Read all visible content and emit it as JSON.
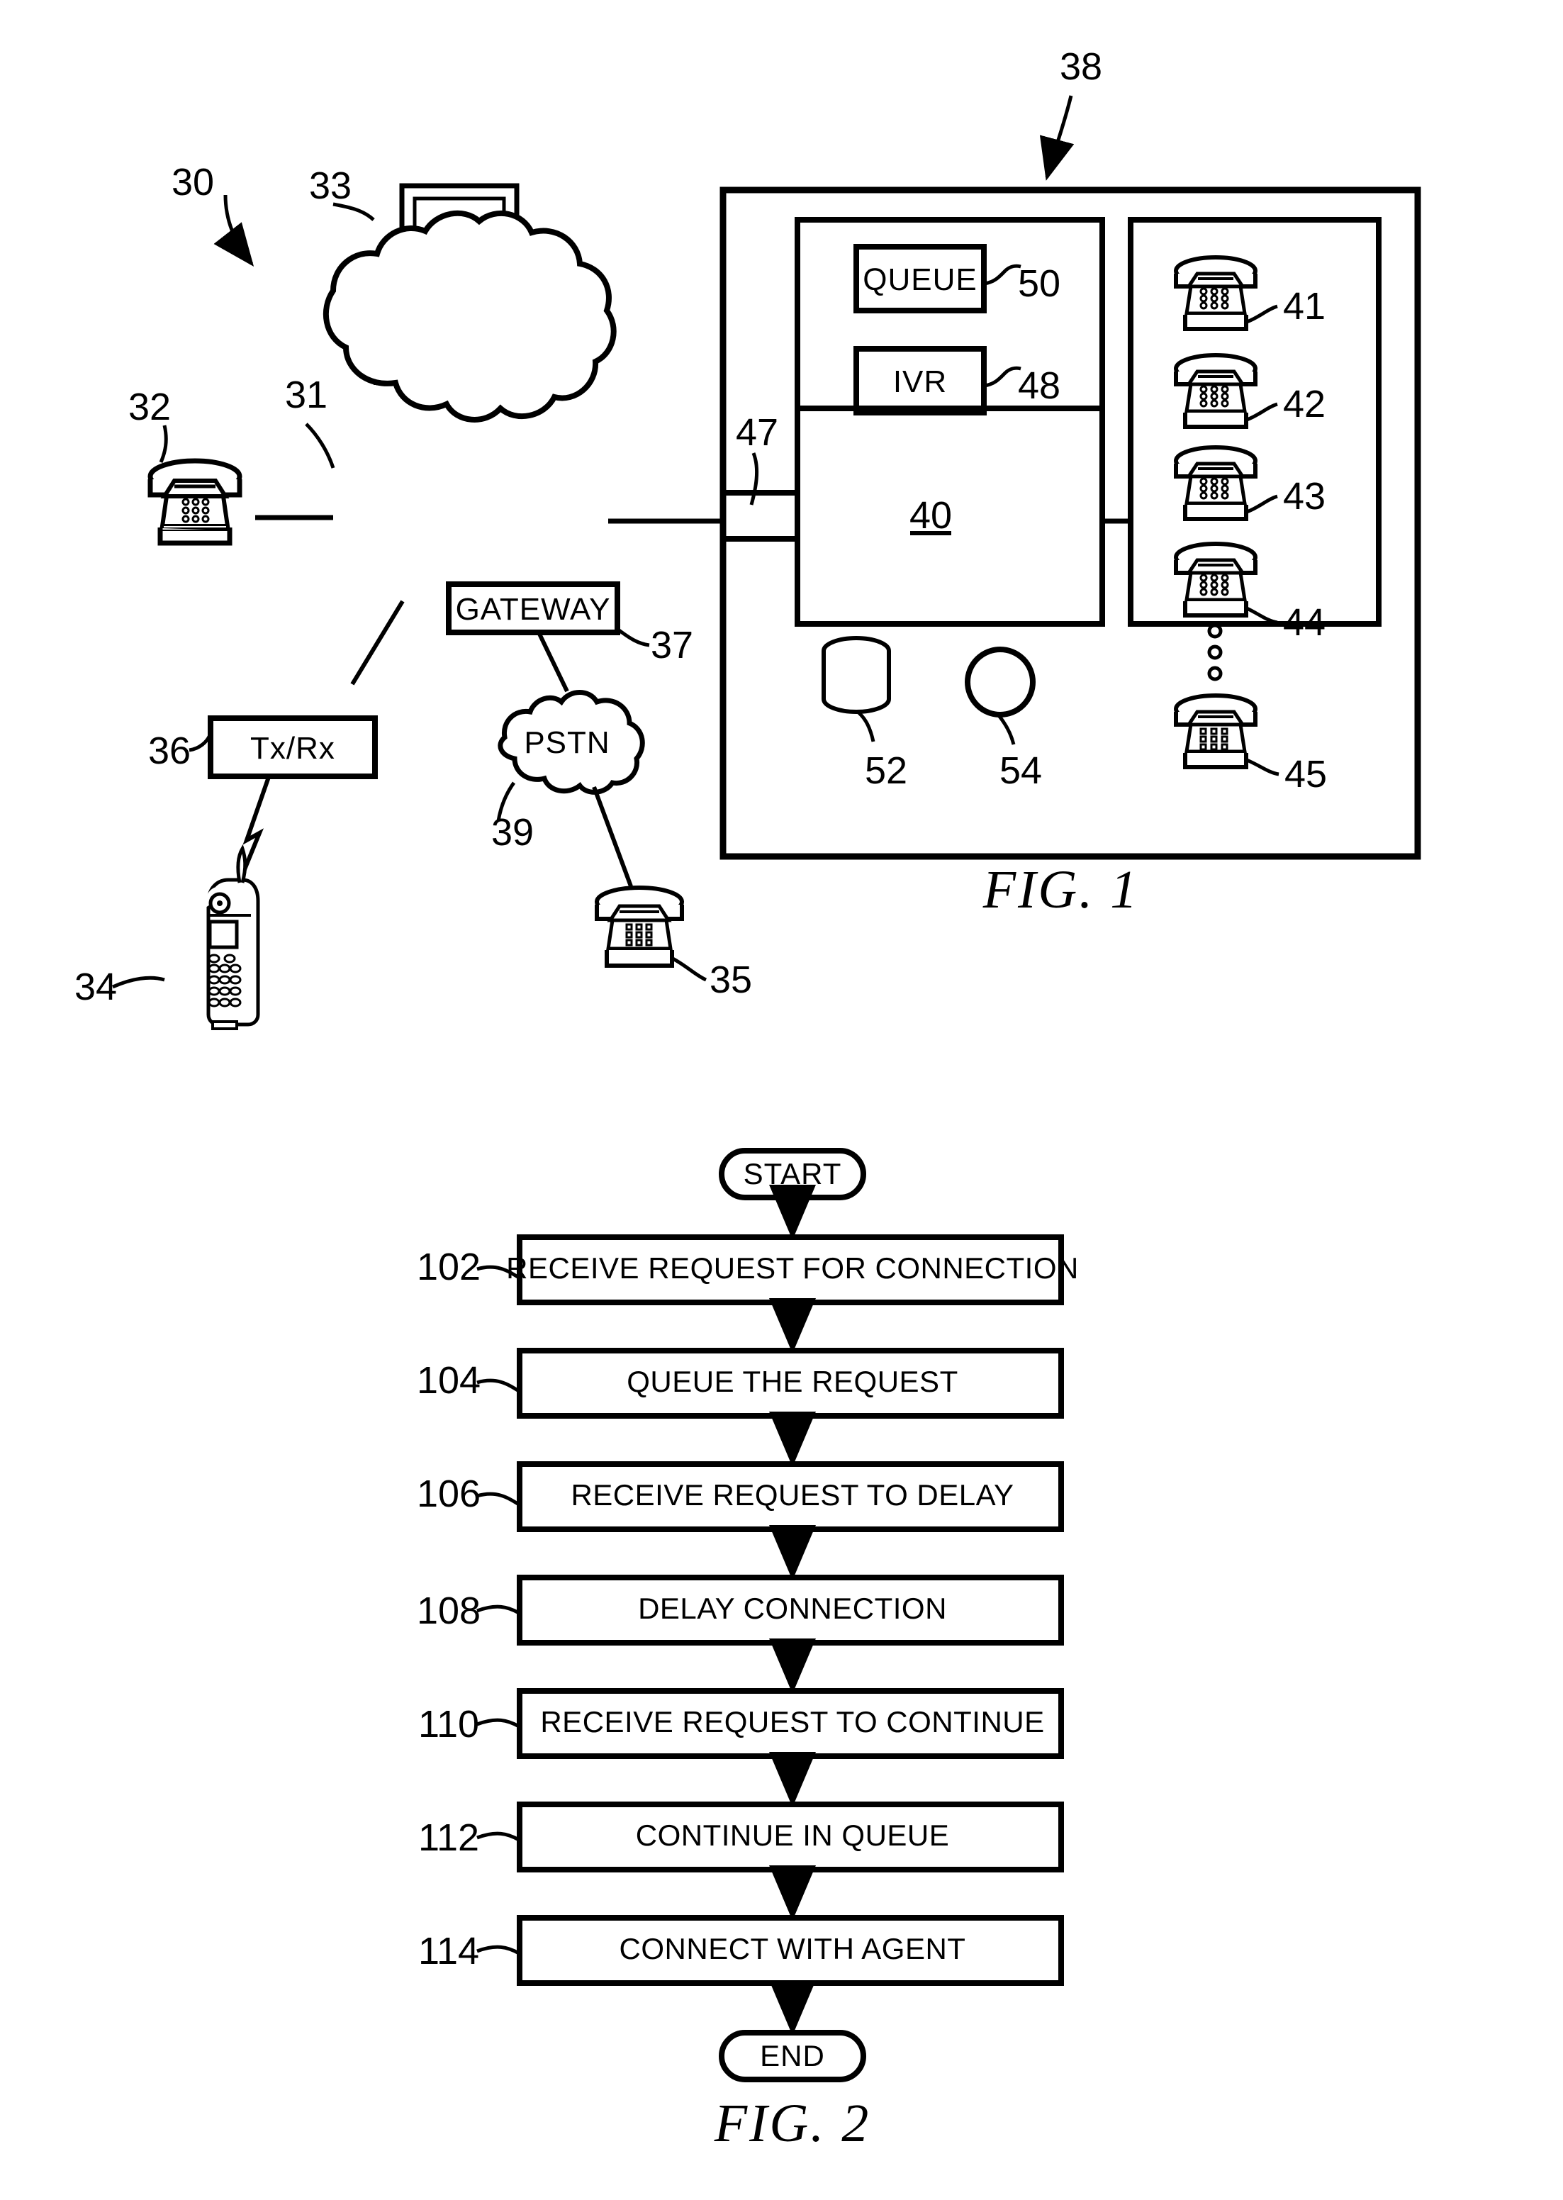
{
  "document": {
    "type": "patent-drawing-sheet",
    "figures": [
      "FIG. 1",
      "FIG. 2"
    ]
  },
  "fig1": {
    "caption": "FIG. 1",
    "system_ref": "30",
    "refs": {
      "system": "30",
      "network_cloud": "31",
      "telephone_left": "32",
      "computer": "33",
      "mobile_phone": "34",
      "pstn_telephone": "35",
      "transceiver": "36",
      "gateway": "37",
      "call_center": "38",
      "pstn_cloud": "39",
      "switch": "40",
      "agent_phone_1": "41",
      "agent_phone_2": "42",
      "agent_phone_3": "43",
      "agent_phone_4": "44",
      "agent_phone_n": "45",
      "trunk_interface": "47",
      "ivr": "48",
      "queue": "50",
      "database": "52",
      "processor": "54"
    },
    "labels": {
      "gateway": "GATEWAY",
      "pstn": "PSTN",
      "txrx": "Tx/Rx",
      "queue": "QUEUE",
      "ivr": "IVR",
      "switch": "40"
    },
    "agent_phones": [
      "41",
      "42",
      "43",
      "44",
      "45"
    ],
    "ellipsis_dots": 3
  },
  "fig2": {
    "caption": "FIG. 2",
    "start_label": "START",
    "end_label": "END",
    "steps": [
      {
        "ref": "102",
        "label": "RECEIVE REQUEST FOR CONNECTION"
      },
      {
        "ref": "104",
        "label": "QUEUE THE REQUEST"
      },
      {
        "ref": "106",
        "label": "RECEIVE REQUEST TO DELAY"
      },
      {
        "ref": "108",
        "label": "DELAY CONNECTION"
      },
      {
        "ref": "110",
        "label": "RECEIVE REQUEST TO CONTINUE"
      },
      {
        "ref": "112",
        "label": "CONTINUE IN QUEUE"
      },
      {
        "ref": "114",
        "label": "CONNECT WITH AGENT"
      }
    ]
  },
  "colors": {
    "ink": "#000000",
    "paper": "#ffffff"
  }
}
